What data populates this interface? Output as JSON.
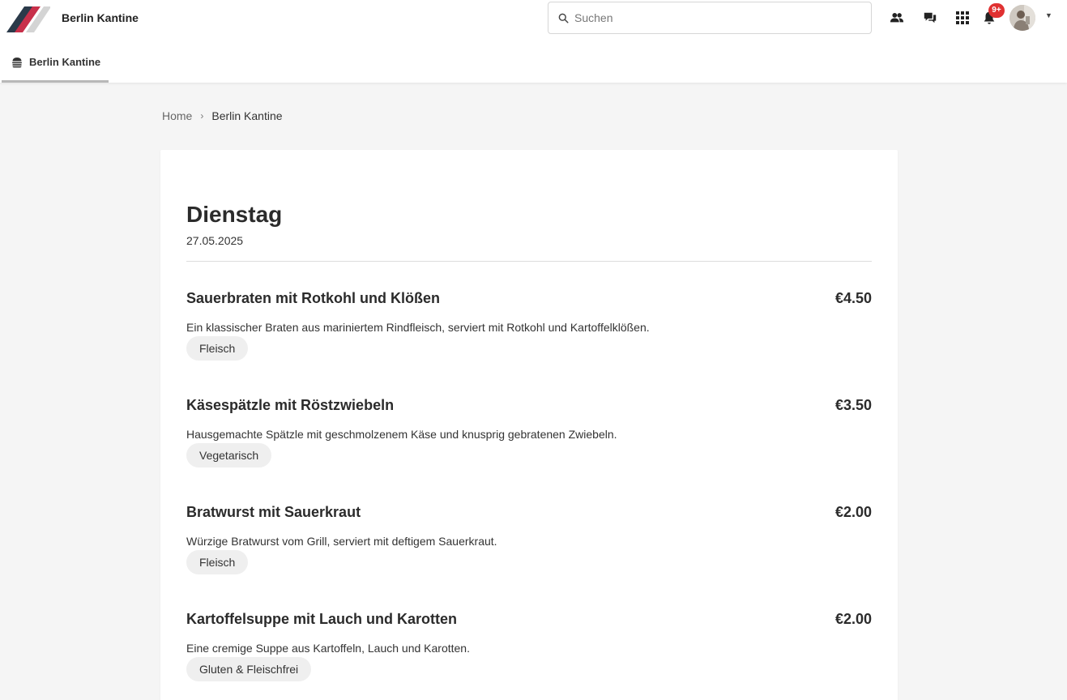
{
  "header": {
    "app_title": "Berlin Kantine",
    "search": {
      "placeholder": "Suchen",
      "value": ""
    },
    "icons": [
      "people-icon",
      "chat-icon",
      "apps-grid-icon",
      "bell-icon"
    ],
    "notification_badge": "9+",
    "colors": {
      "logo_dark": "#2b3a4a",
      "logo_accent": "#c8304a",
      "logo_light": "#d4d4d4",
      "badge": "#e03131"
    }
  },
  "subnav": {
    "tab_label": "Berlin Kantine",
    "tab_icon": "burger-icon"
  },
  "breadcrumb": {
    "home": "Home",
    "separator": "›",
    "current": "Berlin Kantine"
  },
  "menu": {
    "day": "Dienstag",
    "date": "27.05.2025",
    "meals": [
      {
        "name": "Sauerbraten mit Rotkohl und Klößen",
        "price": "€4.50",
        "description": "Ein klassischer Braten aus mariniertem Rindfleisch, serviert mit Rotkohl und Kartoffelklößen.",
        "tag": "Fleisch"
      },
      {
        "name": "Käsespätzle mit Röstzwiebeln",
        "price": "€3.50",
        "description": "Hausgemachte Spätzle mit geschmolzenem Käse und knusprig gebratenen Zwiebeln.",
        "tag": "Vegetarisch"
      },
      {
        "name": "Bratwurst mit Sauerkraut",
        "price": "€2.00",
        "description": "Würzige Bratwurst vom Grill, serviert mit deftigem Sauerkraut.",
        "tag": "Fleisch"
      },
      {
        "name": "Kartoffelsuppe mit Lauch und Karotten",
        "price": "€2.00",
        "description": "Eine cremige Suppe aus Kartoffeln, Lauch und Karotten.",
        "tag": "Gluten & Fleischfrei"
      }
    ]
  }
}
